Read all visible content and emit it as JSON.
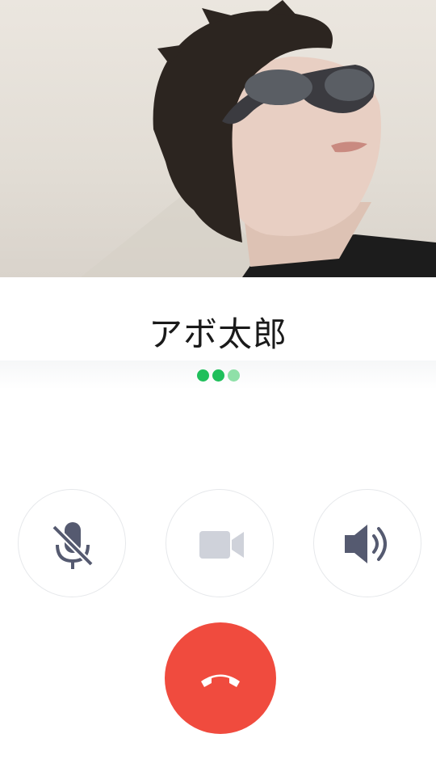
{
  "call": {
    "caller_name": "アボ太郎",
    "status_dots": [
      "#1fbf5b",
      "#1fbf5b",
      "#8fe0a8"
    ]
  },
  "controls": {
    "mute": {
      "icon": "microphone-off-icon",
      "color": "#555a70"
    },
    "video": {
      "icon": "video-camera-icon",
      "color": "#cfd2da"
    },
    "speaker": {
      "icon": "speaker-volume-icon",
      "color": "#555a70"
    }
  },
  "end_call": {
    "icon": "phone-hangup-icon",
    "color": "#f04b3e"
  },
  "photo": {
    "description": "caller-profile-photo"
  }
}
